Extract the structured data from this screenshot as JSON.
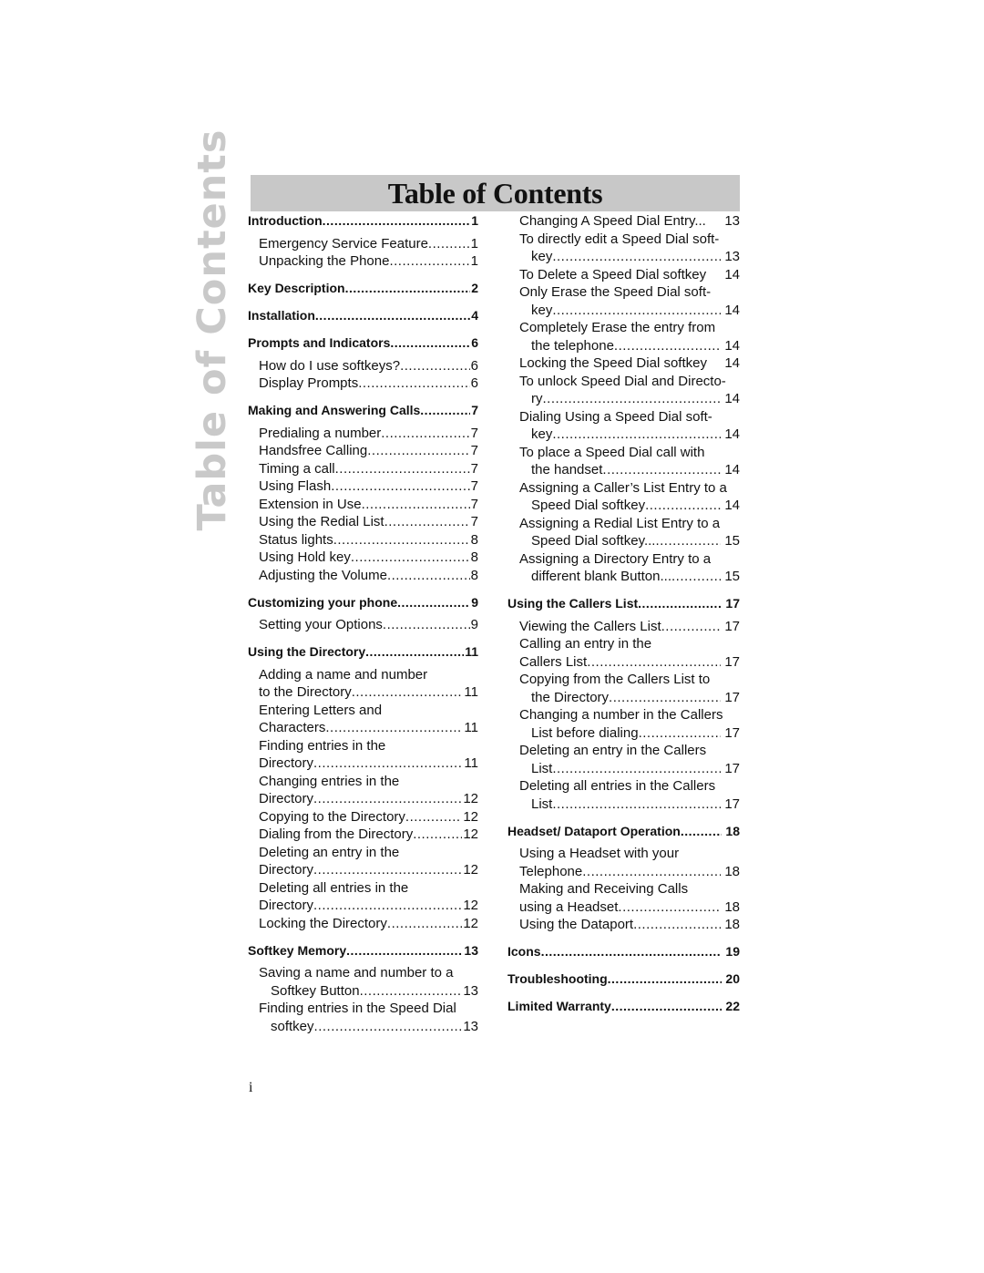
{
  "side_label": "Table of Contents",
  "title": "Table of Contents",
  "page_number": "i",
  "left_column": [
    {
      "type": "head",
      "lines": [
        "Introduction"
      ],
      "page": "1"
    },
    {
      "type": "sub",
      "lines": [
        "Emergency Service Feature"
      ],
      "page": "1"
    },
    {
      "type": "sub",
      "lines": [
        "Unpacking the Phone"
      ],
      "page": "1"
    },
    {
      "type": "head",
      "lines": [
        "Key Description"
      ],
      "page": "2"
    },
    {
      "type": "head",
      "lines": [
        "Installation"
      ],
      "page": "4"
    },
    {
      "type": "head",
      "lines": [
        "Prompts and Indicators"
      ],
      "page": "6"
    },
    {
      "type": "sub",
      "lines": [
        "How do I use softkeys?"
      ],
      "page": "6"
    },
    {
      "type": "sub",
      "lines": [
        "Display Prompts"
      ],
      "page": "6"
    },
    {
      "type": "head",
      "lines": [
        "Making and Answering Calls"
      ],
      "page": "7"
    },
    {
      "type": "sub",
      "lines": [
        "Predialing a number"
      ],
      "page": "7"
    },
    {
      "type": "sub",
      "lines": [
        "Handsfree Calling"
      ],
      "page": "7"
    },
    {
      "type": "sub",
      "lines": [
        "Timing a call"
      ],
      "page": "7"
    },
    {
      "type": "sub",
      "lines": [
        "Using Flash"
      ],
      "page": "7"
    },
    {
      "type": "sub",
      "lines": [
        "Extension in Use"
      ],
      "page": "7"
    },
    {
      "type": "sub",
      "lines": [
        "Using the Redial List"
      ],
      "page": "7"
    },
    {
      "type": "sub",
      "lines": [
        "Status lights"
      ],
      "page": "8"
    },
    {
      "type": "sub",
      "lines": [
        "Using Hold key"
      ],
      "page": "8"
    },
    {
      "type": "sub",
      "lines": [
        "Adjusting the Volume"
      ],
      "page": "8"
    },
    {
      "type": "head",
      "lines": [
        "Customizing your phone"
      ],
      "page": "9"
    },
    {
      "type": "sub",
      "lines": [
        "Setting your Options"
      ],
      "page": "9"
    },
    {
      "type": "head",
      "lines": [
        "Using the Directory"
      ],
      "page": "11"
    },
    {
      "type": "sub",
      "lines": [
        "Adding a name and number",
        "to the Directory"
      ],
      "page": "11"
    },
    {
      "type": "sub",
      "lines": [
        "Entering Letters and",
        "Characters"
      ],
      "page": "11"
    },
    {
      "type": "sub",
      "lines": [
        "Finding entries in the",
        "Directory"
      ],
      "page": "11"
    },
    {
      "type": "sub",
      "lines": [
        "Changing entries in the",
        "Directory"
      ],
      "page": "12"
    },
    {
      "type": "sub",
      "lines": [
        "Copying to the Directory"
      ],
      "page": "12"
    },
    {
      "type": "sub",
      "lines": [
        "Dialing from the Directory"
      ],
      "page": "12"
    },
    {
      "type": "sub",
      "lines": [
        "Deleting an entry in the",
        "Directory"
      ],
      "page": "12"
    },
    {
      "type": "sub",
      "lines": [
        "Deleting all entries in the",
        "Directory"
      ],
      "page": "12"
    },
    {
      "type": "sub",
      "lines": [
        "Locking the Directory"
      ],
      "page": "12"
    },
    {
      "type": "head",
      "lines": [
        "Softkey Memory"
      ],
      "page": "13"
    },
    {
      "type": "sub",
      "hang": true,
      "lines": [
        "Saving a name and number to a",
        "Softkey Button"
      ],
      "page": "13"
    },
    {
      "type": "sub",
      "hang": true,
      "lines": [
        "Finding entries in the Speed Dial",
        "softkey"
      ],
      "page": "13"
    }
  ],
  "right_column": [
    {
      "type": "sub",
      "lines": [
        "Changing A Speed Dial Entry..."
      ],
      "page": "13",
      "nodots": true
    },
    {
      "type": "sub",
      "hang": true,
      "lines": [
        "To directly edit a Speed Dial soft-",
        "key"
      ],
      "page": "13"
    },
    {
      "type": "sub",
      "lines": [
        "To Delete a Speed Dial softkey"
      ],
      "page": "14",
      "nodots": true
    },
    {
      "type": "sub",
      "hang": true,
      "lines": [
        "Only Erase the Speed Dial soft-",
        "key"
      ],
      "page": "14"
    },
    {
      "type": "sub",
      "hang": true,
      "lines": [
        "Completely Erase the entry from",
        "the telephone"
      ],
      "page": "14"
    },
    {
      "type": "sub",
      "lines": [
        "Locking the Speed Dial softkey"
      ],
      "page": "14",
      "nodots": true
    },
    {
      "type": "sub",
      "hang": true,
      "lines": [
        "To unlock Speed Dial and Directo-",
        "ry"
      ],
      "page": "14"
    },
    {
      "type": "sub",
      "hang": true,
      "lines": [
        "Dialing Using a Speed Dial soft-",
        "key"
      ],
      "page": "14"
    },
    {
      "type": "sub",
      "hang": true,
      "lines": [
        "To place a Speed Dial call with",
        "the handset"
      ],
      "page": "14"
    },
    {
      "type": "sub",
      "hang": true,
      "lines": [
        "Assigning a Caller’s List Entry to a",
        "Speed Dial softkey"
      ],
      "page": "14"
    },
    {
      "type": "sub",
      "hang": true,
      "lines": [
        "Assigning a Redial List Entry to a",
        "Speed Dial softkey..."
      ],
      "page": "15"
    },
    {
      "type": "sub",
      "hang": true,
      "lines": [
        "Assigning a Directory Entry to a",
        "different blank Button..."
      ],
      "page": "15"
    },
    {
      "type": "head",
      "lines": [
        "Using the Callers List"
      ],
      "page": "17"
    },
    {
      "type": "sub",
      "lines": [
        "Viewing the Callers List"
      ],
      "page": "17"
    },
    {
      "type": "sub",
      "lines": [
        "Calling an entry in the",
        "Callers List"
      ],
      "page": "17"
    },
    {
      "type": "sub",
      "hang": true,
      "lines": [
        "Copying from the Callers List to",
        "the Directory"
      ],
      "page": "17"
    },
    {
      "type": "sub",
      "hang": true,
      "lines": [
        "Changing a number in the Callers",
        "List before dialing"
      ],
      "page": "17"
    },
    {
      "type": "sub",
      "hang": true,
      "lines": [
        "Deleting an entry in the Callers",
        "List"
      ],
      "page": "17"
    },
    {
      "type": "sub",
      "hang": true,
      "lines": [
        "Deleting all entries in the Callers",
        "List"
      ],
      "page": "17"
    },
    {
      "type": "head",
      "lines": [
        "Headset/ Dataport Operation"
      ],
      "page": "18"
    },
    {
      "type": "sub",
      "lines": [
        "Using a Headset with your",
        "Telephone"
      ],
      "page": "18"
    },
    {
      "type": "sub",
      "lines": [
        "Making and Receiving Calls",
        "using a Headset"
      ],
      "page": "18"
    },
    {
      "type": "sub",
      "lines": [
        "Using the Dataport"
      ],
      "page": "18"
    },
    {
      "type": "head",
      "lines": [
        "Icons"
      ],
      "page": "19"
    },
    {
      "type": "head",
      "lines": [
        "Troubleshooting"
      ],
      "page": "20"
    },
    {
      "type": "head",
      "lines": [
        "Limited Warranty"
      ],
      "page": "22"
    }
  ]
}
